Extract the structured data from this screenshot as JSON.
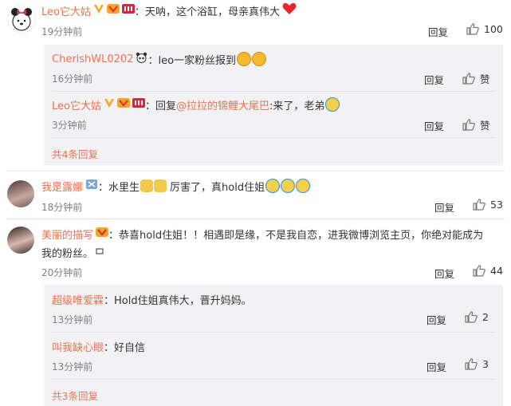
{
  "c1": {
    "user": "Leo它大姑",
    "text": "：天呐，这个浴缸，母亲真伟大",
    "time": "19分钟前",
    "reply_label": "回复",
    "likes": "100",
    "replies": [
      {
        "user": "CherishWL0202",
        "text": "：leo一家粉丝报到",
        "time": "16分钟前",
        "reply_label": "回复",
        "like_label": "赞"
      },
      {
        "user": "Leo它大姑",
        "prefix": "：回复",
        "mention": "@拉拉的锦鲤大尾巴",
        "text": ":来了，老弟",
        "time": "3分钟前",
        "reply_label": "回复",
        "like_label": "赞"
      }
    ],
    "more": "共4条回复"
  },
  "c2": {
    "user": "我是露娜",
    "text1": "：水里生",
    "text2": "厉害了，真hold住姐",
    "time": "18分钟前",
    "reply_label": "回复",
    "likes": "53"
  },
  "c3": {
    "user": "美丽的描写",
    "text_line1": "：恭喜hold住姐！！相遇即是缘，不是我自恋，进我微博浏览主页，你绝对能成为",
    "text_line2": "我的粉丝。",
    "time": "20分钟前",
    "reply_label": "回复",
    "likes": "44",
    "replies": [
      {
        "user": "超级唯爱霖",
        "text": "：Hold住姐真伟大，晋升妈妈。",
        "time": "13分钟前",
        "reply_label": "回复",
        "likes": "2"
      },
      {
        "user": "叫我缺心眼",
        "text": "：好自信",
        "time": "13分钟前",
        "reply_label": "回复",
        "likes": "3"
      }
    ],
    "more": "共3条回复"
  },
  "colors": {
    "name": "#eb7350",
    "reply_bg": "#f2f2f5",
    "time": "#808080"
  },
  "icons": {
    "like": "thumbs-up-icon",
    "verified": "orange-v-icon",
    "emoji": "laughing-crying-emoji"
  }
}
